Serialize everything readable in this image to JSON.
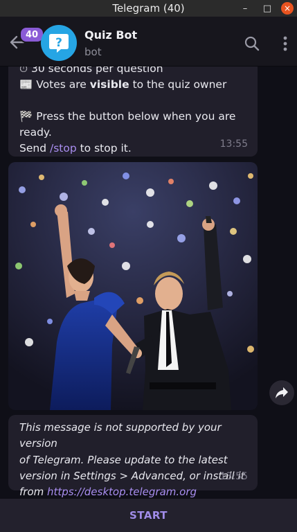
{
  "window": {
    "title": "Telegram (40)",
    "min": "–",
    "max": "□",
    "close": "×"
  },
  "header": {
    "unread_count": "40",
    "chat_name": "Quiz Bot",
    "chat_status": "bot"
  },
  "messages": [
    {
      "lines_a": [
        "30 seconds per question",
        "Votes are ",
        "visible",
        " to the quiz owner"
      ],
      "line_c": " Press the button below when you are",
      "line_d": "ready.",
      "line_e_pre": "Send ",
      "line_e_link": "/stop",
      "line_e_post": " to stop it.",
      "time": "13:55"
    },
    {
      "unsupported_l1": "This message is not supported by your version",
      "unsupported_l2": "of Telegram. Please update to the latest",
      "unsupported_l3": "version in Settings > Advanced, or install it",
      "unsupported_l4_pre": "from ",
      "unsupported_link": "https://desktop.telegram.org",
      "time": "13:55"
    }
  ],
  "bottom": {
    "start_label": "START"
  },
  "colors": {
    "accent": "#a08ce8",
    "badge": "#8a5bd6",
    "avatar": "#26a5e4",
    "bubble": "#211f2b"
  }
}
